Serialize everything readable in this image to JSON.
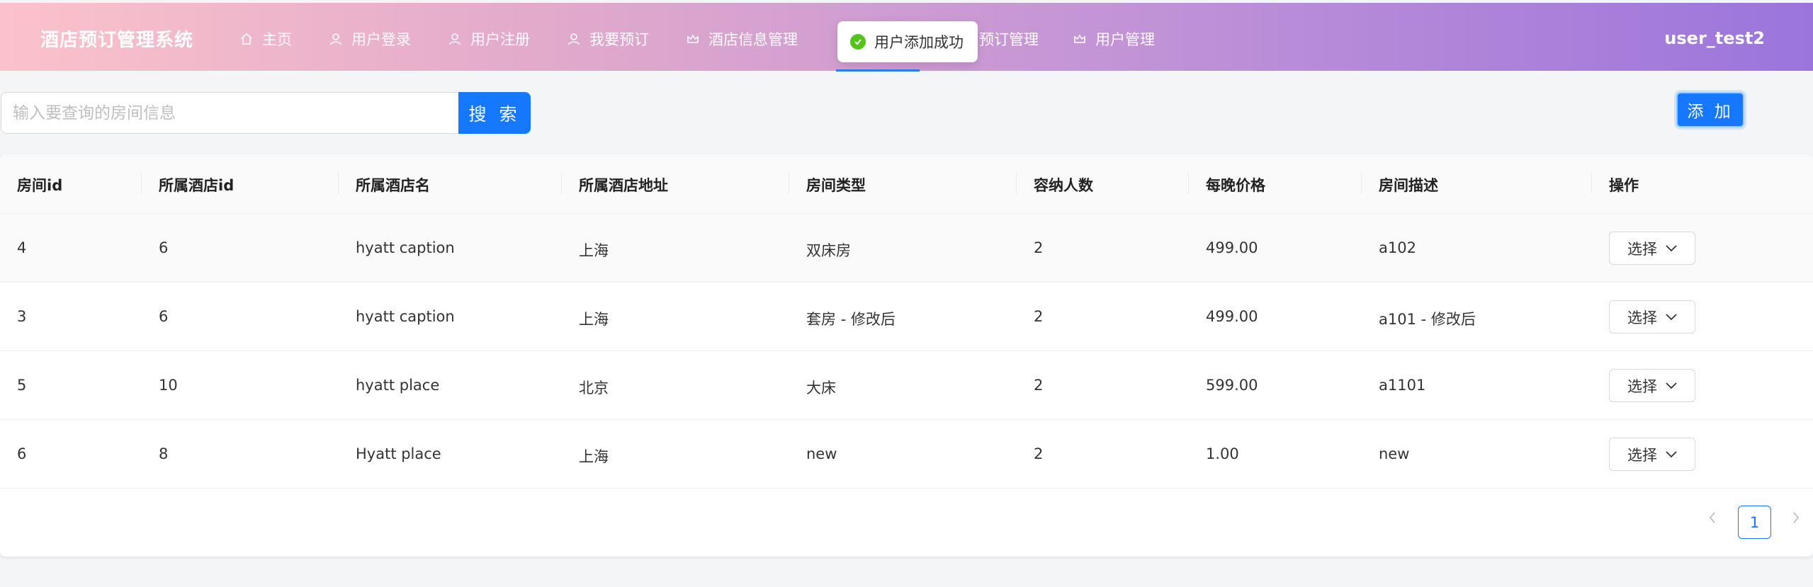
{
  "header": {
    "brand": "酒店预订管理系统",
    "nav": [
      {
        "label": "主页",
        "icon": "home-icon"
      },
      {
        "label": "用户登录",
        "icon": "user-icon"
      },
      {
        "label": "用户注册",
        "icon": "user-icon"
      },
      {
        "label": "我要预订",
        "icon": "user-icon"
      },
      {
        "label": "酒店信息管理",
        "icon": "crown-icon"
      },
      {
        "label": "预订管理",
        "icon": "none"
      },
      {
        "label": "用户管理",
        "icon": "crown-icon"
      }
    ],
    "user": "user_test2"
  },
  "toast": {
    "message": "用户添加成功",
    "icon": "check-circle-icon",
    "color": "#52c41a"
  },
  "search": {
    "placeholder": "输入要查询的房间信息",
    "value": "",
    "button": "搜 索"
  },
  "actions": {
    "add": "添 加"
  },
  "table": {
    "columns": [
      "房间id",
      "所属酒店id",
      "所属酒店名",
      "所属酒店地址",
      "房间类型",
      "容纳人数",
      "每晚价格",
      "房间描述",
      "操作"
    ],
    "rows": [
      {
        "room_id": "4",
        "hotel_id": "6",
        "hotel_name": "hyatt caption",
        "address": "上海",
        "room_type": "双床房",
        "capacity": "2",
        "price": "499.00",
        "description": "a102",
        "action": "选择"
      },
      {
        "room_id": "3",
        "hotel_id": "6",
        "hotel_name": "hyatt caption",
        "address": "上海",
        "room_type": "套房 - 修改后",
        "capacity": "2",
        "price": "499.00",
        "description": "a101 - 修改后",
        "action": "选择"
      },
      {
        "room_id": "5",
        "hotel_id": "10",
        "hotel_name": "hyatt place",
        "address": "北京",
        "room_type": "大床",
        "capacity": "2",
        "price": "599.00",
        "description": "a1101",
        "action": "选择"
      },
      {
        "room_id": "6",
        "hotel_id": "8",
        "hotel_name": "Hyatt place",
        "address": "上海",
        "room_type": "new",
        "capacity": "2",
        "price": "1.00",
        "description": "new",
        "action": "选择"
      }
    ]
  },
  "pagination": {
    "current": "1"
  },
  "colors": {
    "primary": "#1677ff",
    "gradient_start": "#fbc2cb",
    "gradient_end": "#9b75dc"
  }
}
